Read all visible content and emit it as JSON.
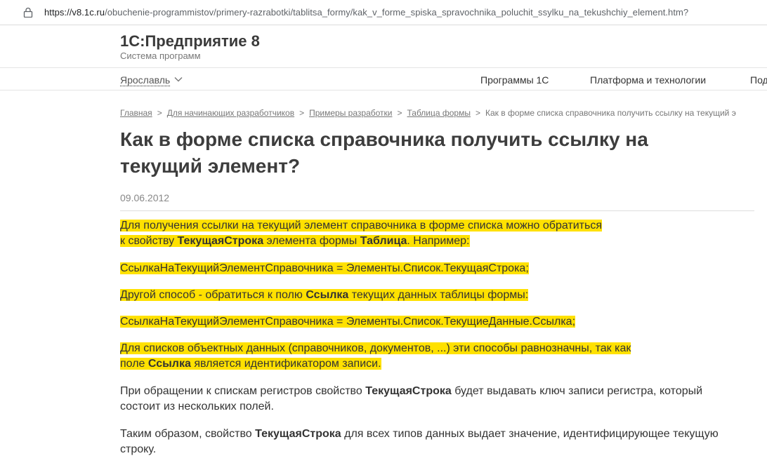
{
  "browser": {
    "url_host": "https://v8.1c.ru",
    "url_path": "/obuchenie-programmistov/primery-razrabotki/tablitsa_formy/kak_v_forme_spiska_spravochnika_poluchit_ssylku_na_tekushchiy_element.htm?"
  },
  "header": {
    "title": "1С:Предприятие 8",
    "subtitle": "Система программ"
  },
  "nav": {
    "city": "Ярославль",
    "links": [
      "Программы 1С",
      "Платформа и технологии",
      "Под"
    ]
  },
  "breadcrumb": {
    "items": [
      "Главная",
      "Для начинающих разработчиков",
      "Примеры разработки",
      "Таблица формы"
    ],
    "separator": ">",
    "current": "Как в форме списка справочника получить ссылку на текущий э"
  },
  "article": {
    "title_line1": "Как в форме списка справочника получить ссылку на",
    "title_line2": "текущий элемент?",
    "date": "09.06.2012",
    "p1_line1": "Для получения ссылки на текущий элемент справочника в форме списка можно обратиться",
    "p1_line2_a": "к свойству ",
    "p1_line2_b": "ТекущаяСтрока",
    "p1_line2_c": " элемента формы ",
    "p1_line2_d": "Таблица",
    "p1_line2_e": ". Например:",
    "code1": "СсылкаНаТекущийЭлементСправочника = Элементы.Список.ТекущаяСтрока;",
    "p2_a": "Другой способ - обратиться к полю ",
    "p2_b": "Ссылка",
    "p2_c": " текущих данных таблицы формы:",
    "code2": "СсылкаНаТекущийЭлементСправочника = Элементы.Список.ТекущиеДанные.Ссылка;",
    "p3_line1": "Для списков объектных данных (справочников, документов, ...) эти способы равнозначны, так как",
    "p3_line2_a": "поле ",
    "p3_line2_b": "Ссылка",
    "p3_line2_c": " является идентификатором записи.",
    "p4_line1_a": "При обращении к спискам регистров свойство ",
    "p4_line1_b": "ТекущаяСтрока",
    "p4_line1_c": " будет выдавать ключ записи регистра, который",
    "p4_line2": "состоит из нескольких полей.",
    "p5_line1_a": "Таким образом, свойство ",
    "p5_line1_b": "ТекущаяСтрока",
    "p5_line1_c": " для всех типов данных выдает значение, идентифицирующее текущую",
    "p5_line2": "строку."
  },
  "colors": {
    "highlight": "#ffe100",
    "text": "#333333",
    "muted": "#777777"
  }
}
